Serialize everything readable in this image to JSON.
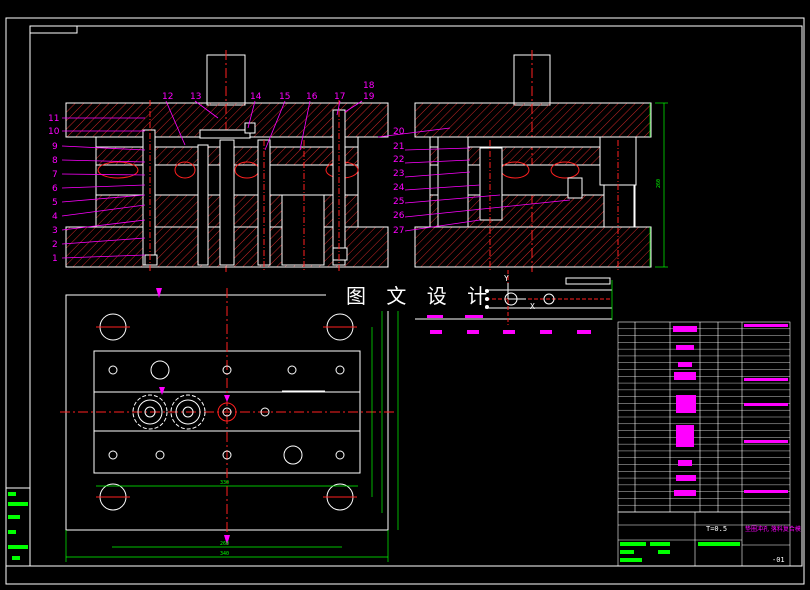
{
  "watermark": "图 文 设 计",
  "callouts_left": [
    "11",
    "10",
    "9",
    "8",
    "7",
    "6",
    "5",
    "4",
    "3",
    "2",
    "1"
  ],
  "callouts_top": [
    "12",
    "13",
    "14",
    "15",
    "16",
    "17",
    "18",
    "19"
  ],
  "callouts_right": [
    "20",
    "21",
    "22",
    "23",
    "24",
    "25",
    "26",
    "27"
  ],
  "axis_labels": {
    "y": "Y",
    "x": "X"
  },
  "dimensions": {
    "plan_width_inner": "330",
    "plan_width_mid": "260",
    "plan_width_outer": "340",
    "side_height": "260"
  },
  "title_block": {
    "part_name": "垫圈冲孔 落料复合模",
    "thickness": "T=0.5",
    "drawing_no": "-01"
  },
  "colors": {
    "background": "#000000",
    "lines": "#ffffff",
    "accent": "#ff00ff",
    "centerline": "#ff0000",
    "dimension": "#00ff00",
    "section_hatch": "#ff0000"
  }
}
